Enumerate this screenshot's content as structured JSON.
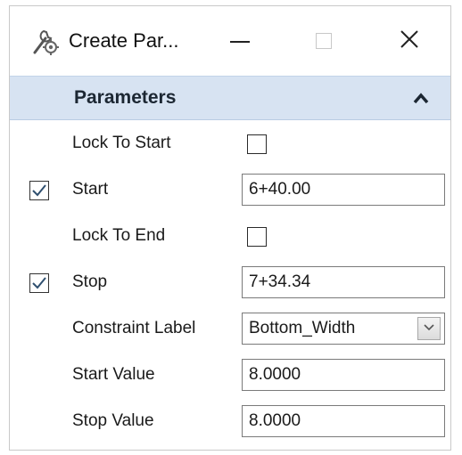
{
  "window": {
    "title": "Create Par...",
    "icon": "wrench-gear-icon"
  },
  "section": {
    "title": "Parameters",
    "collapse_icon": "chevron-up-icon"
  },
  "fields": {
    "lock_to_start": {
      "label": "Lock To Start",
      "checked": false
    },
    "start": {
      "label": "Start",
      "enabled": true,
      "value": "6+40.00"
    },
    "lock_to_end": {
      "label": "Lock To End",
      "checked": false
    },
    "stop": {
      "label": "Stop",
      "enabled": true,
      "value": "7+34.34"
    },
    "constraint_label": {
      "label": "Constraint Label",
      "value": "Bottom_Width"
    },
    "start_value": {
      "label": "Start Value",
      "value": "8.0000"
    },
    "stop_value": {
      "label": "Stop Value",
      "value": "8.0000"
    }
  },
  "colors": {
    "section_header_bg": "#d7e3f2",
    "check_mark": "#2f4f6f"
  }
}
